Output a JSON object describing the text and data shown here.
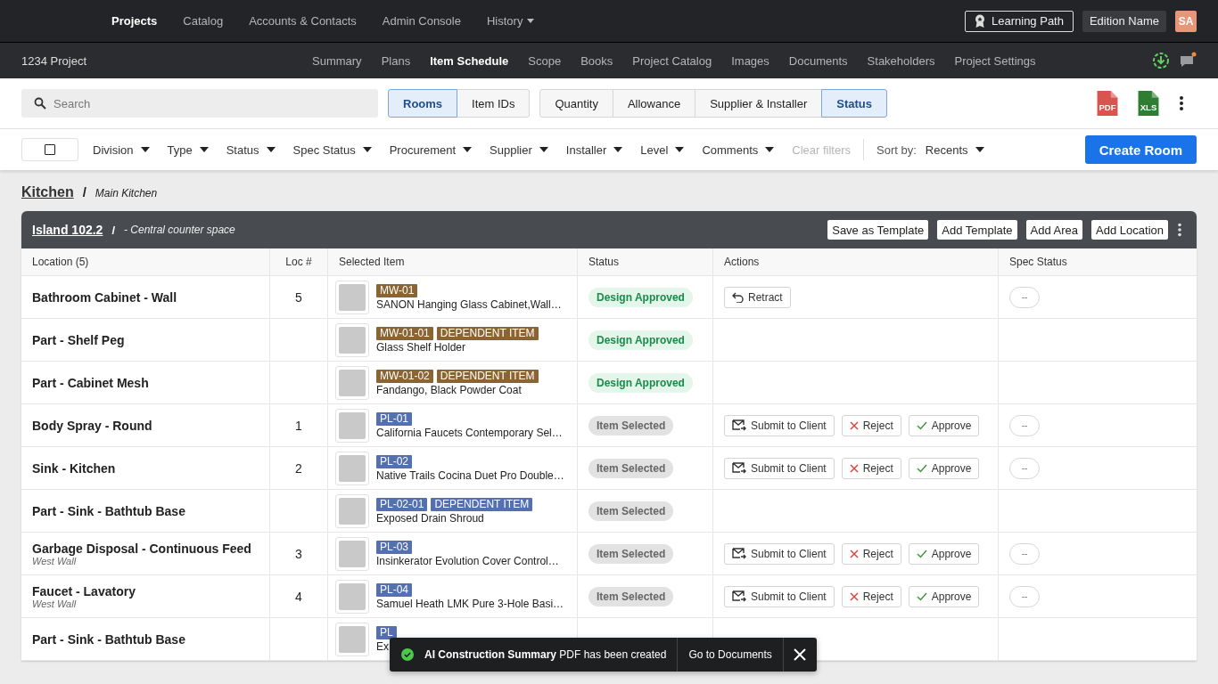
{
  "top_nav": {
    "items": [
      {
        "label": "Projects",
        "selected": true,
        "dropdown": false
      },
      {
        "label": "Catalog",
        "selected": false,
        "dropdown": false
      },
      {
        "label": "Accounts & Contacts",
        "selected": false,
        "dropdown": false
      },
      {
        "label": "Admin Console",
        "selected": false,
        "dropdown": false
      },
      {
        "label": "History",
        "selected": false,
        "dropdown": true
      }
    ],
    "learning_path": "Learning Path",
    "edition": "Edition Name",
    "avatar": "SA"
  },
  "project_nav": {
    "project": "1234 Project",
    "tabs": [
      {
        "label": "Summary",
        "selected": false
      },
      {
        "label": "Plans",
        "selected": false
      },
      {
        "label": "Item Schedule",
        "selected": true
      },
      {
        "label": "Scope",
        "selected": false
      },
      {
        "label": "Books",
        "selected": false
      },
      {
        "label": "Project Catalog",
        "selected": false
      },
      {
        "label": "Images",
        "selected": false
      },
      {
        "label": "Documents",
        "selected": false
      },
      {
        "label": "Stakeholders",
        "selected": false
      },
      {
        "label": "Project Settings",
        "selected": false
      }
    ]
  },
  "toolbar": {
    "search": {
      "placeholder": "Search"
    },
    "view_toggle": [
      {
        "label": "Rooms",
        "selected": true
      },
      {
        "label": "Item IDs",
        "selected": false
      }
    ],
    "column_toggle": [
      {
        "label": "Quantity",
        "selected": false
      },
      {
        "label": "Allowance",
        "selected": false
      },
      {
        "label": "Supplier & Installer",
        "selected": false
      },
      {
        "label": "Status",
        "selected": true
      }
    ],
    "exports": [
      {
        "label": "PDF",
        "color": "#d9534f"
      },
      {
        "label": "XLS",
        "color": "#2e7d32"
      }
    ]
  },
  "filters": {
    "select_all": {
      "checked": false
    },
    "items": [
      "Division",
      "Type",
      "Status",
      "Spec Status",
      "Procurement",
      "Supplier",
      "Installer",
      "Level",
      "Comments"
    ],
    "clear": {
      "label": "Clear filters",
      "disabled": true
    },
    "sort": {
      "label": "Sort by:",
      "value": "Recents"
    },
    "create_button": "Create Room"
  },
  "breadcrumb": {
    "room": "Kitchen",
    "separator": "/",
    "description": "Main Kitchen"
  },
  "area": {
    "name": "Island 102.2",
    "separator": "/",
    "description": "- Central counter space",
    "buttons": [
      "Save as Template",
      "Add Template",
      "Add Area",
      "Add Location"
    ]
  },
  "table": {
    "columns": [
      "Location (5)",
      "Loc #",
      "Selected Item",
      "Status",
      "Actions",
      "Spec Status"
    ],
    "rows": [
      {
        "location": "Bathroom Cabinet - Wall",
        "loc": "5",
        "tags": [
          {
            "label": "MW-01",
            "color": "#8b6434"
          }
        ],
        "item": "SANON Hanging Glass Cabinet,Wall…",
        "status": {
          "label": "Design Approved",
          "kind": "approved"
        },
        "actions": [
          {
            "label": "Retract",
            "kind": "retract"
          }
        ],
        "spec_status": "--"
      },
      {
        "location": "Part - Shelf Peg",
        "tags": [
          {
            "label": "MW-01-01",
            "color": "#8b6434"
          },
          {
            "label": "DEPENDENT ITEM",
            "color": "#8b6434"
          }
        ],
        "item": "Glass Shelf Holder",
        "status": {
          "label": "Design Approved",
          "kind": "approved"
        }
      },
      {
        "location": "Part - Cabinet Mesh",
        "tags": [
          {
            "label": "MW-01-02",
            "color": "#8b6434"
          },
          {
            "label": "DEPENDENT ITEM",
            "color": "#8b6434"
          }
        ],
        "item": "Fandango, Black Powder Coat",
        "status": {
          "label": "Design Approved",
          "kind": "approved"
        }
      },
      {
        "location": "Body Spray - Round",
        "loc": "1",
        "tags": [
          {
            "label": "PL-01",
            "color": "#5470b0"
          }
        ],
        "item": "California Faucets Contemporary Sel…",
        "status": {
          "label": "Item Selected",
          "kind": "selected"
        },
        "actions": [
          {
            "label": "Submit to Client",
            "kind": "submit"
          },
          {
            "label": "Reject",
            "kind": "reject"
          },
          {
            "label": "Approve",
            "kind": "approve"
          }
        ],
        "spec_status": "--"
      },
      {
        "location": "Sink - Kitchen",
        "loc": "2",
        "tags": [
          {
            "label": "PL-02",
            "color": "#5470b0"
          }
        ],
        "item": "Native Trails Cocina Duet Pro Double…",
        "status": {
          "label": "Item Selected",
          "kind": "selected"
        },
        "actions": [
          {
            "label": "Submit to Client",
            "kind": "submit"
          },
          {
            "label": "Reject",
            "kind": "reject"
          },
          {
            "label": "Approve",
            "kind": "approve"
          }
        ],
        "spec_status": "--"
      },
      {
        "location": "Part - Sink - Bathtub Base",
        "tags": [
          {
            "label": "PL-02-01",
            "color": "#5470b0"
          },
          {
            "label": "DEPENDENT ITEM",
            "color": "#5470b0"
          }
        ],
        "item": "Exposed Drain Shroud",
        "status": {
          "label": "Item Selected",
          "kind": "selected"
        }
      },
      {
        "location": "Garbage Disposal - Continuous Feed",
        "sublocation": "West Wall",
        "loc": "3",
        "tags": [
          {
            "label": "PL-03",
            "color": "#5470b0"
          }
        ],
        "item": "Insinkerator Evolution Cover Control…",
        "status": {
          "label": "Item Selected",
          "kind": "selected"
        },
        "actions": [
          {
            "label": "Submit to Client",
            "kind": "submit"
          },
          {
            "label": "Reject",
            "kind": "reject"
          },
          {
            "label": "Approve",
            "kind": "approve"
          }
        ],
        "spec_status": "--"
      },
      {
        "location": "Faucet - Lavatory",
        "sublocation": "West Wall",
        "loc": "4",
        "tags": [
          {
            "label": "PL-04",
            "color": "#5470b0"
          }
        ],
        "item": "Samuel Heath LMK Pure 3-Hole Basi…",
        "status": {
          "label": "Item Selected",
          "kind": "selected"
        },
        "actions": [
          {
            "label": "Submit to Client",
            "kind": "submit"
          },
          {
            "label": "Reject",
            "kind": "reject"
          },
          {
            "label": "Approve",
            "kind": "approve"
          }
        ],
        "spec_status": "--"
      },
      {
        "location": "Part - Sink - Bathtub Base",
        "tags": [
          {
            "label": "PL",
            "color": "#5470b0"
          }
        ],
        "item": "Ex"
      }
    ]
  },
  "toast": {
    "title": "AI Construction Summary",
    "message": "PDF has been created",
    "action": "Go to Documents"
  }
}
